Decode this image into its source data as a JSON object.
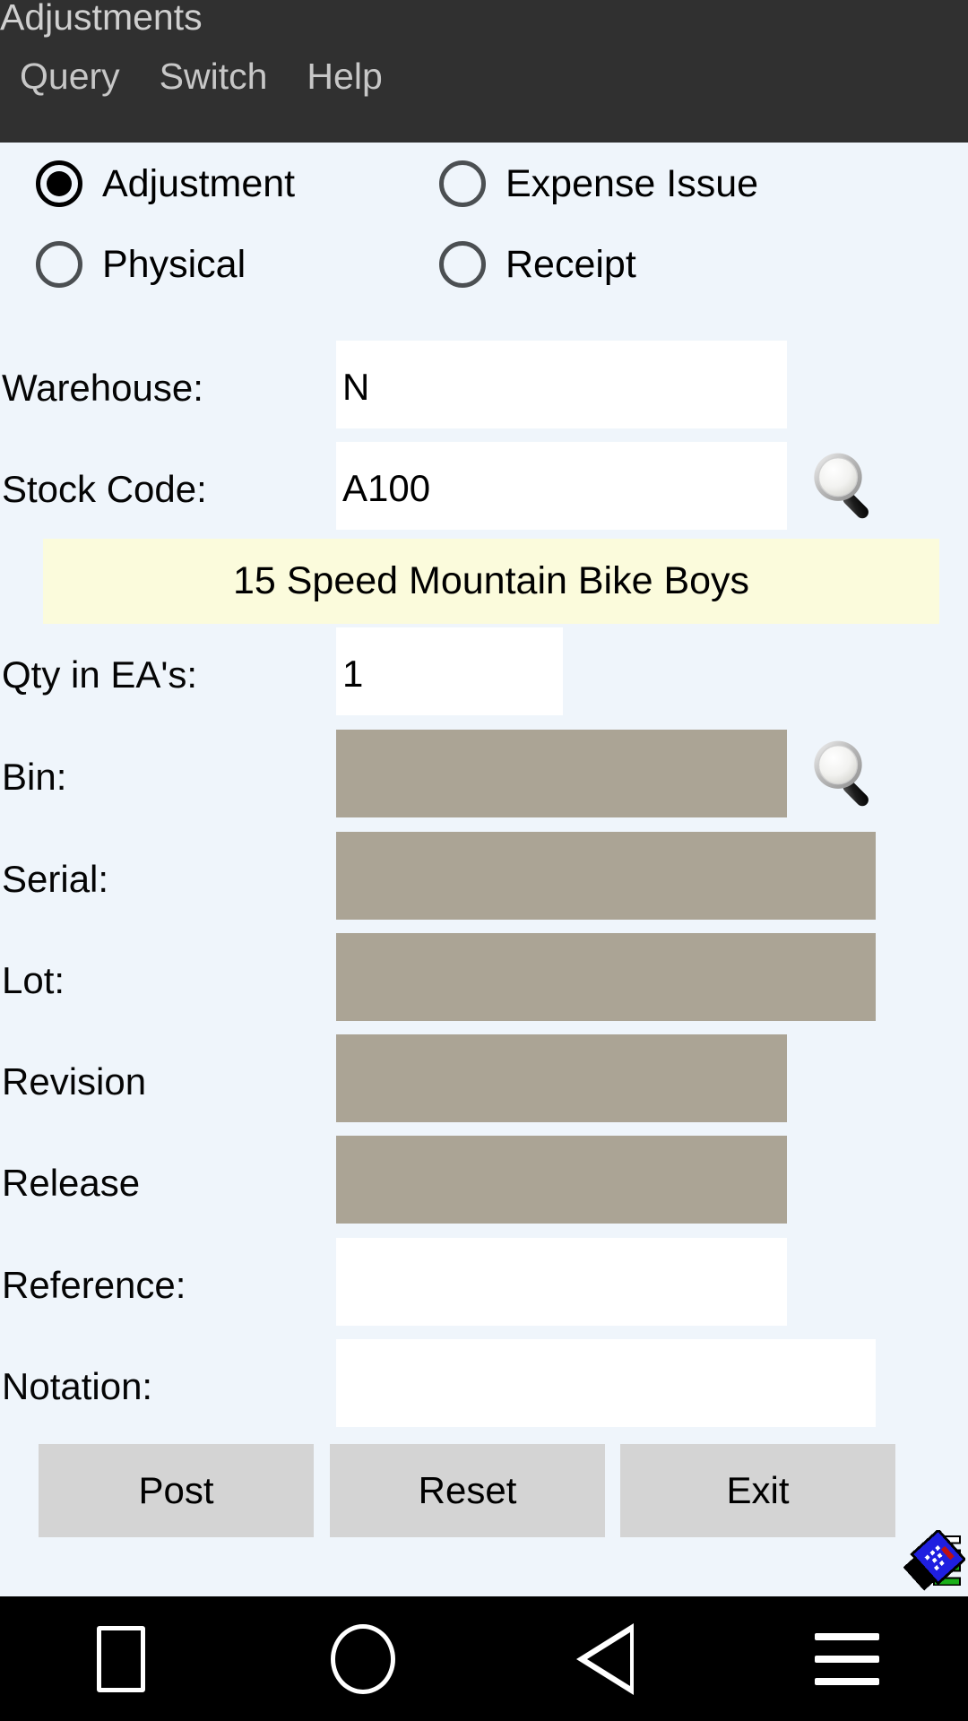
{
  "titlebar": {
    "app_title": "Adjustments",
    "menu": [
      {
        "label": "Query",
        "name": "menu-query"
      },
      {
        "label": "Switch",
        "name": "menu-switch"
      },
      {
        "label": "Help",
        "name": "menu-help"
      }
    ]
  },
  "transaction_type": {
    "options": [
      {
        "label": "Adjustment",
        "checked": true
      },
      {
        "label": "Expense Issue",
        "checked": false
      },
      {
        "label": "Physical",
        "checked": false
      },
      {
        "label": "Receipt",
        "checked": false
      }
    ]
  },
  "fields": {
    "warehouse": {
      "label": "Warehouse:",
      "value": "N",
      "placeholder": "",
      "enabled": true,
      "lookup": false
    },
    "stock_code": {
      "label": "Stock Code:",
      "value": "A100",
      "placeholder": "",
      "enabled": true,
      "lookup": true
    },
    "qty": {
      "label": "Qty in EA's:",
      "value": "1",
      "placeholder": "",
      "enabled": true,
      "lookup": false
    },
    "bin": {
      "label": "Bin:",
      "value": "",
      "placeholder": "",
      "enabled": false,
      "lookup": true
    },
    "serial": {
      "label": "Serial:",
      "value": "",
      "placeholder": "",
      "enabled": false,
      "lookup": false
    },
    "lot": {
      "label": "Lot:",
      "value": "",
      "placeholder": "",
      "enabled": false,
      "lookup": false
    },
    "revision": {
      "label": "Revision",
      "value": "",
      "placeholder": "",
      "enabled": false,
      "lookup": false
    },
    "release": {
      "label": "Release",
      "value": "",
      "placeholder": "",
      "enabled": false,
      "lookup": false
    },
    "reference": {
      "label": "Reference:",
      "value": "",
      "placeholder": "",
      "enabled": true,
      "lookup": false
    },
    "notation": {
      "label": "Notation:",
      "value": "",
      "placeholder": "",
      "enabled": true,
      "lookup": false
    }
  },
  "description_strip": {
    "text": "15 Speed Mountain Bike Boys"
  },
  "buttons": {
    "post": "Post",
    "reset": "Reset",
    "exit": "Exit"
  },
  "icons": {
    "lookup": "magnifier-icon",
    "scanner_badge": "barcode-scanner-icon"
  },
  "navbar": {
    "recents": "recents-square-icon",
    "home": "home-circle-icon",
    "back": "back-triangle-icon",
    "menu": "hamburger-menu-icon"
  },
  "colors": {
    "page_background": "#eff5fb",
    "titlebar": "#303030",
    "titlebar_text": "#cfcfcf",
    "input_enabled": "#ffffff",
    "input_disabled": "#aba495",
    "description_strip": "#fbfbdc",
    "button_face": "#d4d4d4",
    "navbar": "#000000"
  }
}
